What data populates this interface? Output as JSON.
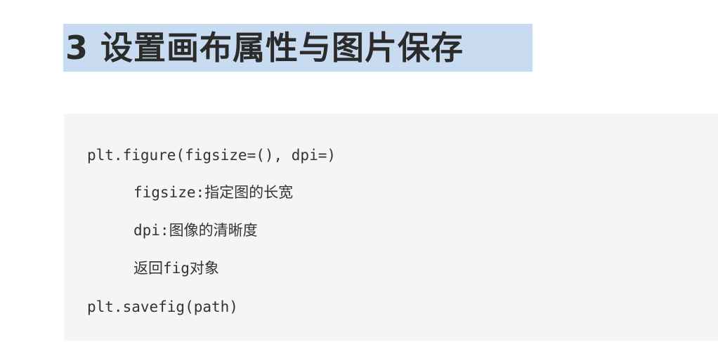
{
  "title": "3 设置画布属性与图片保存",
  "code": {
    "lines": [
      "plt.figure(figsize=(), dpi=)",
      "figsize:指定图的长宽",
      "dpi:图像的清晰度",
      "返回fig对象",
      "plt.savefig(path)"
    ]
  },
  "colors": {
    "title_highlight": "#c9dbf0",
    "code_background": "#f5f5f5",
    "title_text": "#2b2b2b",
    "code_text": "#333333"
  }
}
